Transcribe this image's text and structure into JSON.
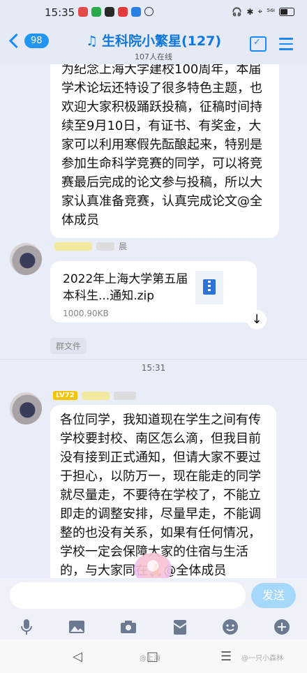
{
  "status": {
    "time": "15:35",
    "right_text": "⁵⁶ᴵ"
  },
  "header": {
    "back_count": "98",
    "title": "生科院小繁星(127)",
    "online": "107人在线"
  },
  "msg1": {
    "text": "为纪念上海大学建校100周年，本届学术论坛还特设了很多特色主题，也欢迎大家积极踊跃投稿，征稿时间持续至9月10日，有证书、有奖金，大家可以利用寒假先酝酿起来，特别是参加生命科学竞赛的同学，可以将竞赛最后完成的论文参与投稿，所以大家认真准备竞赛，认真完成论文@全体成员"
  },
  "file_msg": {
    "nick_suffix": "晨",
    "filename": "2022年上海大学第五届本科生...通知.zip",
    "size": "1000.90KB",
    "tag": "群文件"
  },
  "timestamp": "15:31",
  "msg2": {
    "level": "LV72",
    "text": "各位同学，我知道现在学生之间有传学校要封校、南区怎么滴，但我目前没有接到正式通知，但请大家不要过于担心，以防万一，现在能走的同学就尽量走，不要待在学校了，不能立即走的调整安排，尽量早走，不能调整的也没有关系，如果有任何情况，学校一定会保障大家的住宿与生活的，与大家同在🙏@全体成员"
  },
  "input": {
    "send_label": "发送"
  },
  "toolbar": {
    "icons": [
      "mic-icon",
      "image-icon",
      "camera-icon",
      "red-packet-icon",
      "emoji-icon",
      "plus-icon"
    ]
  },
  "nav": {
    "back": "◁",
    "home": "□",
    "menu": "☰",
    "watermark1": "@上海",
    "watermark2": "@一只小森林"
  }
}
